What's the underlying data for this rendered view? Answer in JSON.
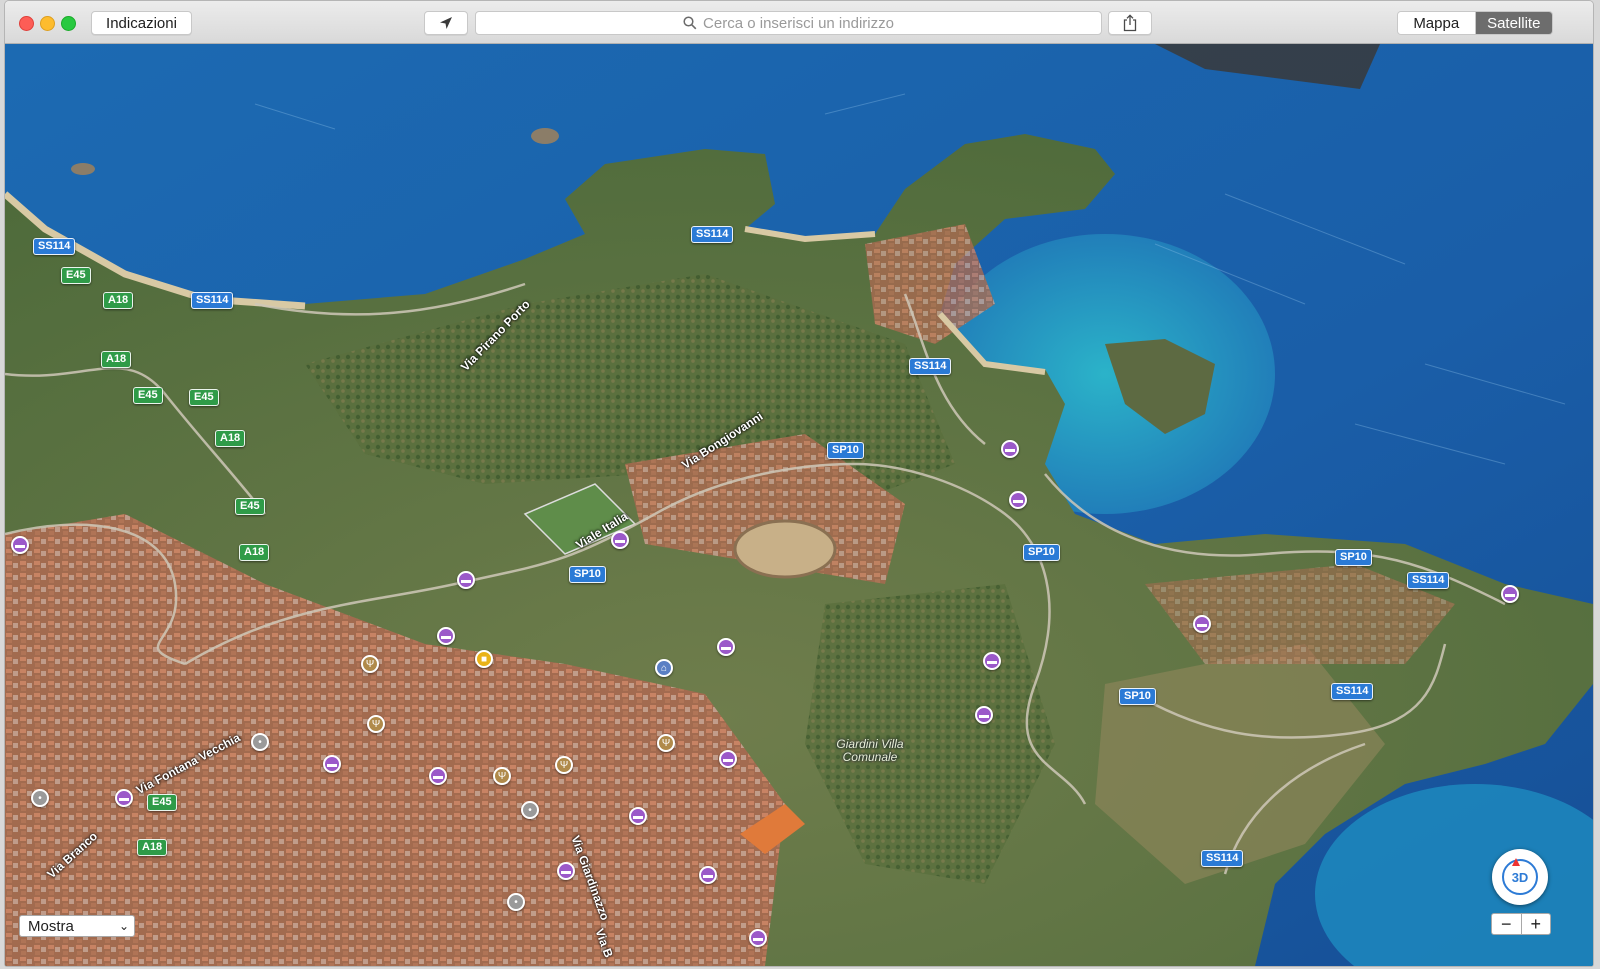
{
  "window": {
    "toolbar": {
      "directions_label": "Indicazioni",
      "location_icon": "location-arrow-icon",
      "search_placeholder": "Cerca o inserisci un indirizzo",
      "search_icon": "search-icon",
      "share_icon": "share-icon",
      "view_modes": [
        "Mappa",
        "Satellite"
      ],
      "selected_view": "Satellite"
    }
  },
  "map": {
    "road_shields": [
      {
        "text": "SS114",
        "type": "ss"
      },
      {
        "text": "SS114",
        "type": "ss"
      },
      {
        "text": "SS114",
        "type": "ss"
      },
      {
        "text": "SS114",
        "type": "ss"
      },
      {
        "text": "SS114",
        "type": "ss"
      },
      {
        "text": "SS114",
        "type": "ss"
      },
      {
        "text": "SS114",
        "type": "ss"
      },
      {
        "text": "SP10",
        "type": "sp"
      },
      {
        "text": "SP10",
        "type": "sp"
      },
      {
        "text": "SP10",
        "type": "sp"
      },
      {
        "text": "SP10",
        "type": "sp"
      },
      {
        "text": "SP10",
        "type": "sp"
      },
      {
        "text": "E45",
        "type": "e"
      },
      {
        "text": "E45",
        "type": "e"
      },
      {
        "text": "E45",
        "type": "e"
      },
      {
        "text": "E45",
        "type": "e"
      },
      {
        "text": "E45",
        "type": "e"
      },
      {
        "text": "A18",
        "type": "a"
      },
      {
        "text": "A18",
        "type": "a"
      },
      {
        "text": "A18",
        "type": "a"
      },
      {
        "text": "A18",
        "type": "a"
      },
      {
        "text": "A18",
        "type": "a"
      }
    ],
    "streets": [
      "Via Pirano Porto",
      "Via Bongiovanni",
      "Viale Italia",
      "Via Fontana Vecchia",
      "Via Branco",
      "Via Giardinazzo",
      "Via B"
    ],
    "poi_label": "Giardini Villa Comunale",
    "colors": {
      "sea_deep": "#1d5fa8",
      "sea_shallow": "#2aa7c4",
      "land": "#5d7a43",
      "town": "#c07a5a",
      "shield_blue": "#2a7ad6",
      "shield_green": "#2f9b48",
      "hotel_pin": "#9b59c9"
    }
  },
  "controls": {
    "show_select_value": "Mostra",
    "compass_label": "3D",
    "zoom_out": "−",
    "zoom_in": "+"
  }
}
